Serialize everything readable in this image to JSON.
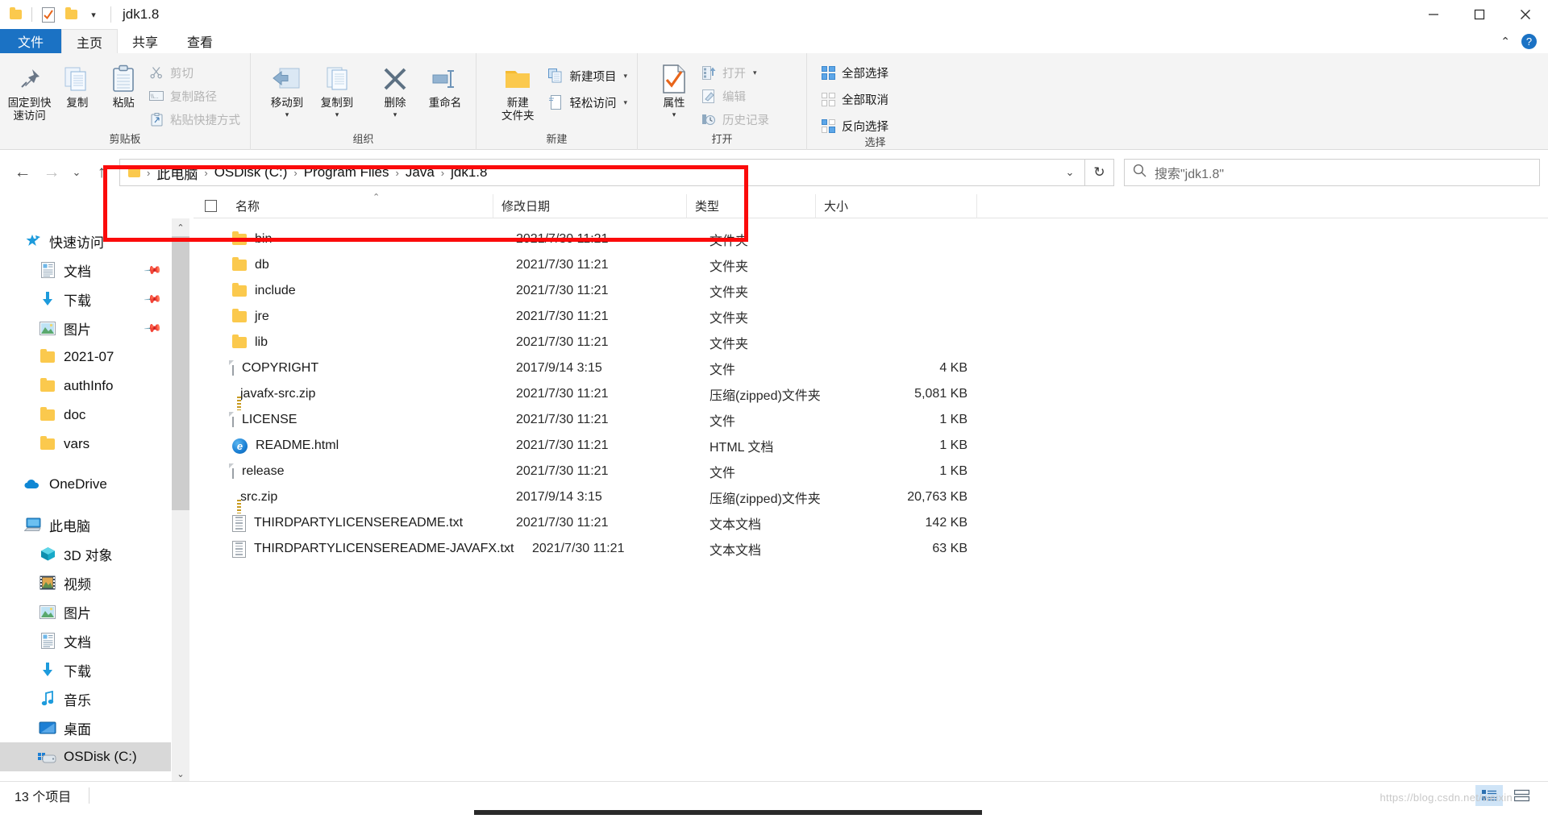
{
  "titlebar": {
    "title": "jdk1.8",
    "qat": [
      {
        "name": "folder-icon",
        "label": "folder"
      },
      {
        "name": "properties-icon",
        "label": "properties"
      },
      {
        "name": "new-folder-icon",
        "label": "new-folder"
      },
      {
        "name": "customize-qat-caret",
        "label": "▾"
      }
    ],
    "minimize": "—",
    "maximize": "❐",
    "close": "✕"
  },
  "tabs": [
    {
      "label": "文件",
      "name": "tab-file"
    },
    {
      "label": "主页",
      "name": "tab-home"
    },
    {
      "label": "共享",
      "name": "tab-share"
    },
    {
      "label": "查看",
      "name": "tab-view"
    }
  ],
  "tabstrip_right": {
    "collapse": "⌃",
    "help": "?"
  },
  "ribbon": {
    "groups": [
      {
        "label": "剪贴板",
        "big": [
          {
            "label": "固定到快\n速访问",
            "icon": "pin-icon"
          },
          {
            "label": "复制",
            "icon": "copy-icon"
          },
          {
            "label": "粘贴",
            "icon": "paste-icon"
          }
        ],
        "small": [
          {
            "label": "剪切",
            "icon": "scissors-icon",
            "disabled": true
          },
          {
            "label": "复制路径",
            "icon": "copy-path-icon",
            "disabled": true
          },
          {
            "label": "粘贴快捷方式",
            "icon": "paste-shortcut-icon",
            "disabled": true
          }
        ]
      },
      {
        "label": "组织",
        "big": [
          {
            "label": "移动到",
            "icon": "move-to-icon",
            "caret": true
          },
          {
            "label": "复制到",
            "icon": "copy-to-icon",
            "caret": true
          },
          {
            "label": "删除",
            "icon": "delete-icon",
            "caret": true
          },
          {
            "label": "重命名",
            "icon": "rename-icon"
          }
        ],
        "small": []
      },
      {
        "label": "新建",
        "big": [
          {
            "label": "新建\n文件夹",
            "icon": "new-folder-icon"
          }
        ],
        "small": [
          {
            "label": "新建项目",
            "icon": "new-item-icon",
            "caret": true
          },
          {
            "label": "轻松访问",
            "icon": "easy-access-icon",
            "caret": true
          }
        ]
      },
      {
        "label": "打开",
        "big": [
          {
            "label": "属性",
            "icon": "properties-icon",
            "caret": true
          }
        ],
        "small": [
          {
            "label": "打开",
            "icon": "open-icon",
            "caret": true,
            "disabled": true
          },
          {
            "label": "编辑",
            "icon": "edit-icon",
            "disabled": true
          },
          {
            "label": "历史记录",
            "icon": "history-icon",
            "disabled": true
          }
        ]
      },
      {
        "label": "选择",
        "big": [],
        "small": [
          {
            "label": "全部选择",
            "icon": "select-all-icon"
          },
          {
            "label": "全部取消",
            "icon": "select-none-icon"
          },
          {
            "label": "反向选择",
            "icon": "invert-selection-icon"
          }
        ]
      }
    ]
  },
  "addressbar": {
    "back": "←",
    "forward": "→",
    "recent": "⌄",
    "up": "↑",
    "crumbs": [
      "此电脑",
      "OSDisk (C:)",
      "Program Files",
      "Java",
      "jdk1.8"
    ],
    "separator": "›",
    "dropdown": "⌄",
    "refresh": "↻",
    "search_placeholder": "搜索\"jdk1.8\"",
    "search_value": ""
  },
  "columns": [
    {
      "label": "名称",
      "name": "column-name"
    },
    {
      "label": "修改日期",
      "name": "column-date"
    },
    {
      "label": "类型",
      "name": "column-type"
    },
    {
      "label": "大小",
      "name": "column-size"
    }
  ],
  "sidebar": {
    "items": [
      {
        "label": "快速访问",
        "icon": "quick-access-star-icon",
        "level": 0,
        "pinned": false
      },
      {
        "label": "文档",
        "icon": "documents-icon",
        "level": 1,
        "pinned": true
      },
      {
        "label": "下载",
        "icon": "downloads-icon",
        "level": 1,
        "pinned": true
      },
      {
        "label": "图片",
        "icon": "pictures-icon",
        "level": 1,
        "pinned": true
      },
      {
        "label": "2021-07",
        "icon": "folder-icon",
        "level": 1,
        "pinned": false
      },
      {
        "label": "authInfo",
        "icon": "folder-icon",
        "level": 1,
        "pinned": false
      },
      {
        "label": "doc",
        "icon": "folder-icon",
        "level": 1,
        "pinned": false
      },
      {
        "label": "vars",
        "icon": "folder-icon",
        "level": 1,
        "pinned": false
      },
      {
        "label": "OneDrive",
        "icon": "onedrive-cloud-icon",
        "level": 0,
        "pinned": false,
        "gap_before": true
      },
      {
        "label": "此电脑",
        "icon": "this-pc-icon",
        "level": 0,
        "pinned": false,
        "gap_before": true
      },
      {
        "label": "3D 对象",
        "icon": "3d-objects-icon",
        "level": 1,
        "pinned": false
      },
      {
        "label": "视频",
        "icon": "videos-icon",
        "level": 1,
        "pinned": false
      },
      {
        "label": "图片",
        "icon": "pictures-icon",
        "level": 1,
        "pinned": false
      },
      {
        "label": "文档",
        "icon": "documents-icon",
        "level": 1,
        "pinned": false
      },
      {
        "label": "下载",
        "icon": "downloads-icon",
        "level": 1,
        "pinned": false
      },
      {
        "label": "音乐",
        "icon": "music-icon",
        "level": 1,
        "pinned": false
      },
      {
        "label": "桌面",
        "icon": "desktop-icon",
        "level": 1,
        "pinned": false
      },
      {
        "label": "OSDisk (C:)",
        "icon": "drive-icon",
        "level": 1,
        "pinned": false,
        "selected": true
      }
    ]
  },
  "files": [
    {
      "name": "bin",
      "date": "2021/7/30 11:21",
      "type": "文件夹",
      "size": "",
      "icon": "folder-icon"
    },
    {
      "name": "db",
      "date": "2021/7/30 11:21",
      "type": "文件夹",
      "size": "",
      "icon": "folder-icon"
    },
    {
      "name": "include",
      "date": "2021/7/30 11:21",
      "type": "文件夹",
      "size": "",
      "icon": "folder-icon"
    },
    {
      "name": "jre",
      "date": "2021/7/30 11:21",
      "type": "文件夹",
      "size": "",
      "icon": "folder-icon"
    },
    {
      "name": "lib",
      "date": "2021/7/30 11:21",
      "type": "文件夹",
      "size": "",
      "icon": "folder-icon"
    },
    {
      "name": "COPYRIGHT",
      "date": "2017/9/14 3:15",
      "type": "文件",
      "size": "4 KB",
      "icon": "file-icon"
    },
    {
      "name": "javafx-src.zip",
      "date": "2021/7/30 11:21",
      "type": "压缩(zipped)文件夹",
      "size": "5,081 KB",
      "icon": "zip-icon"
    },
    {
      "name": "LICENSE",
      "date": "2021/7/30 11:21",
      "type": "文件",
      "size": "1 KB",
      "icon": "file-icon"
    },
    {
      "name": "README.html",
      "date": "2021/7/30 11:21",
      "type": "HTML 文档",
      "size": "1 KB",
      "icon": "html-icon"
    },
    {
      "name": "release",
      "date": "2021/7/30 11:21",
      "type": "文件",
      "size": "1 KB",
      "icon": "file-icon"
    },
    {
      "name": "src.zip",
      "date": "2017/9/14 3:15",
      "type": "压缩(zipped)文件夹",
      "size": "20,763 KB",
      "icon": "zip-icon"
    },
    {
      "name": "THIRDPARTYLICENSEREADME.txt",
      "date": "2021/7/30 11:21",
      "type": "文本文档",
      "size": "142 KB",
      "icon": "text-icon"
    },
    {
      "name": "THIRDPARTYLICENSEREADME-JAVAFX.txt",
      "date": "2021/7/30 11:21",
      "type": "文本文档",
      "size": "63 KB",
      "icon": "text-icon"
    }
  ],
  "statusbar": {
    "item_count": "13 个项目",
    "details_view": "details-view-icon",
    "tiles_view": "tiles-view-icon"
  },
  "colors": {
    "accent": "#1b72c4",
    "annotation": "#fb0b0b",
    "folder": "#fbc94d",
    "selection": "#d8d8d8"
  }
}
